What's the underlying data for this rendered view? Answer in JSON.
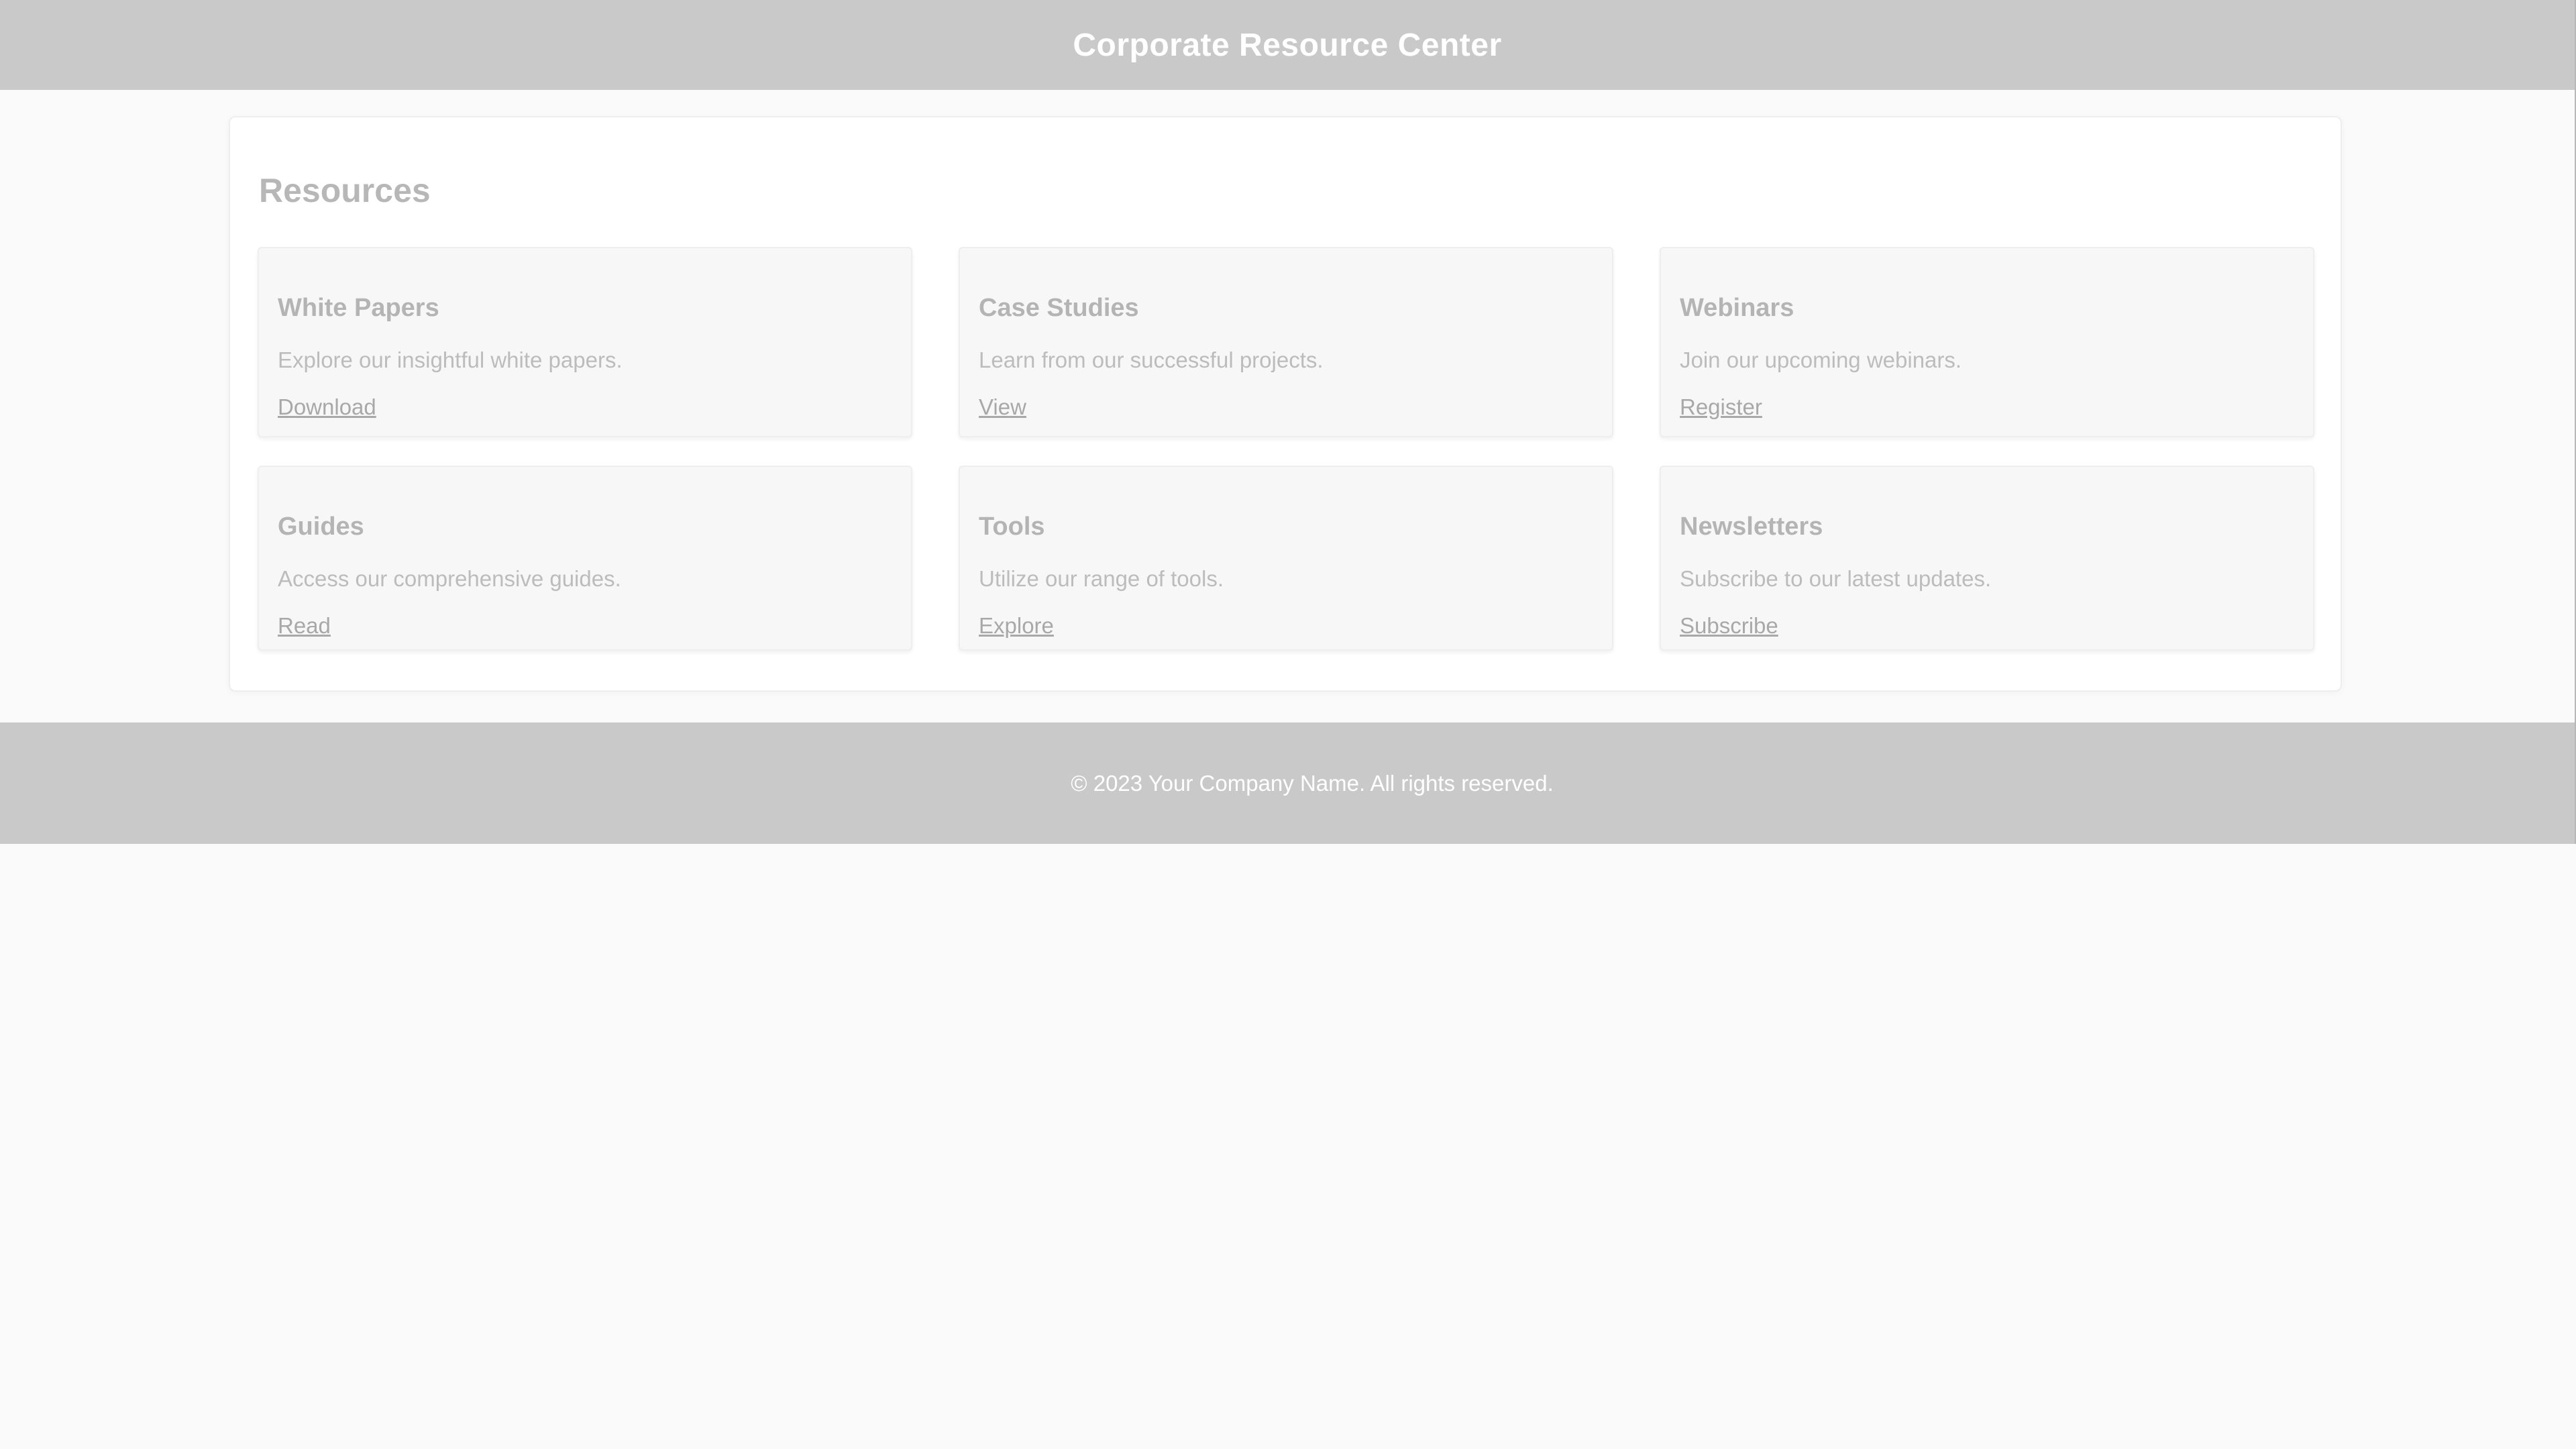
{
  "header": {
    "title": "Corporate Resource Center"
  },
  "resources": {
    "title": "Resources",
    "cards": [
      {
        "title": "White Papers",
        "description": "Explore our insightful white papers.",
        "link": "Download"
      },
      {
        "title": "Case Studies",
        "description": "Learn from our successful projects.",
        "link": "View"
      },
      {
        "title": "Webinars",
        "description": "Join our upcoming webinars.",
        "link": "Register"
      },
      {
        "title": "Guides",
        "description": "Access our comprehensive guides.",
        "link": "Read"
      },
      {
        "title": "Tools",
        "description": "Utilize our range of tools.",
        "link": "Explore"
      },
      {
        "title": "Newsletters",
        "description": "Subscribe to our latest updates.",
        "link": "Subscribe"
      }
    ]
  },
  "footer": {
    "text": "© 2023 Your Company Name. All rights reserved."
  },
  "colors": {
    "header_bg": "#c9c9c9",
    "footer_bg": "#c9c9c9",
    "page_bg": "#fafafa",
    "card_bg": "#f7f7f7"
  }
}
